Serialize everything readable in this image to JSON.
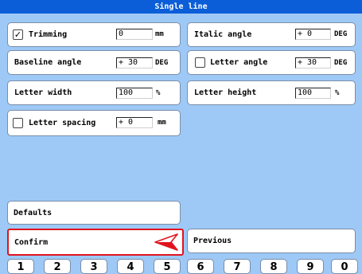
{
  "title": "Single line",
  "left": {
    "trimming": {
      "checked": true,
      "check_glyph": "✓",
      "label": "Trimming",
      "value": "0",
      "unit": "mm"
    },
    "baseline_angle": {
      "label": "Baseline angle",
      "value": "+ 30",
      "unit": "DEG"
    },
    "letter_width": {
      "label": "Letter width",
      "value": "100",
      "unit": "%"
    },
    "letter_spacing": {
      "checked": false,
      "label": "Letter spacing",
      "value": "+ 0",
      "unit": "mm"
    }
  },
  "right": {
    "italic_angle": {
      "label": "Italic angle",
      "value": "+ 0",
      "unit": "DEG"
    },
    "letter_angle": {
      "checked": false,
      "label": "Letter angle",
      "value": "+ 30",
      "unit": "DEG"
    },
    "letter_height": {
      "label": "Letter height",
      "value": "100",
      "unit": "%"
    }
  },
  "buttons": {
    "defaults": "Defaults",
    "confirm": "Confirm",
    "previous": "Previous"
  },
  "keypad": [
    "1",
    "2",
    "3",
    "4",
    "5",
    "6",
    "7",
    "8",
    "9",
    "0"
  ],
  "colors": {
    "background": "#9ec9f6",
    "titlebar": "#0b5ed7",
    "highlight": "#e0141e"
  }
}
